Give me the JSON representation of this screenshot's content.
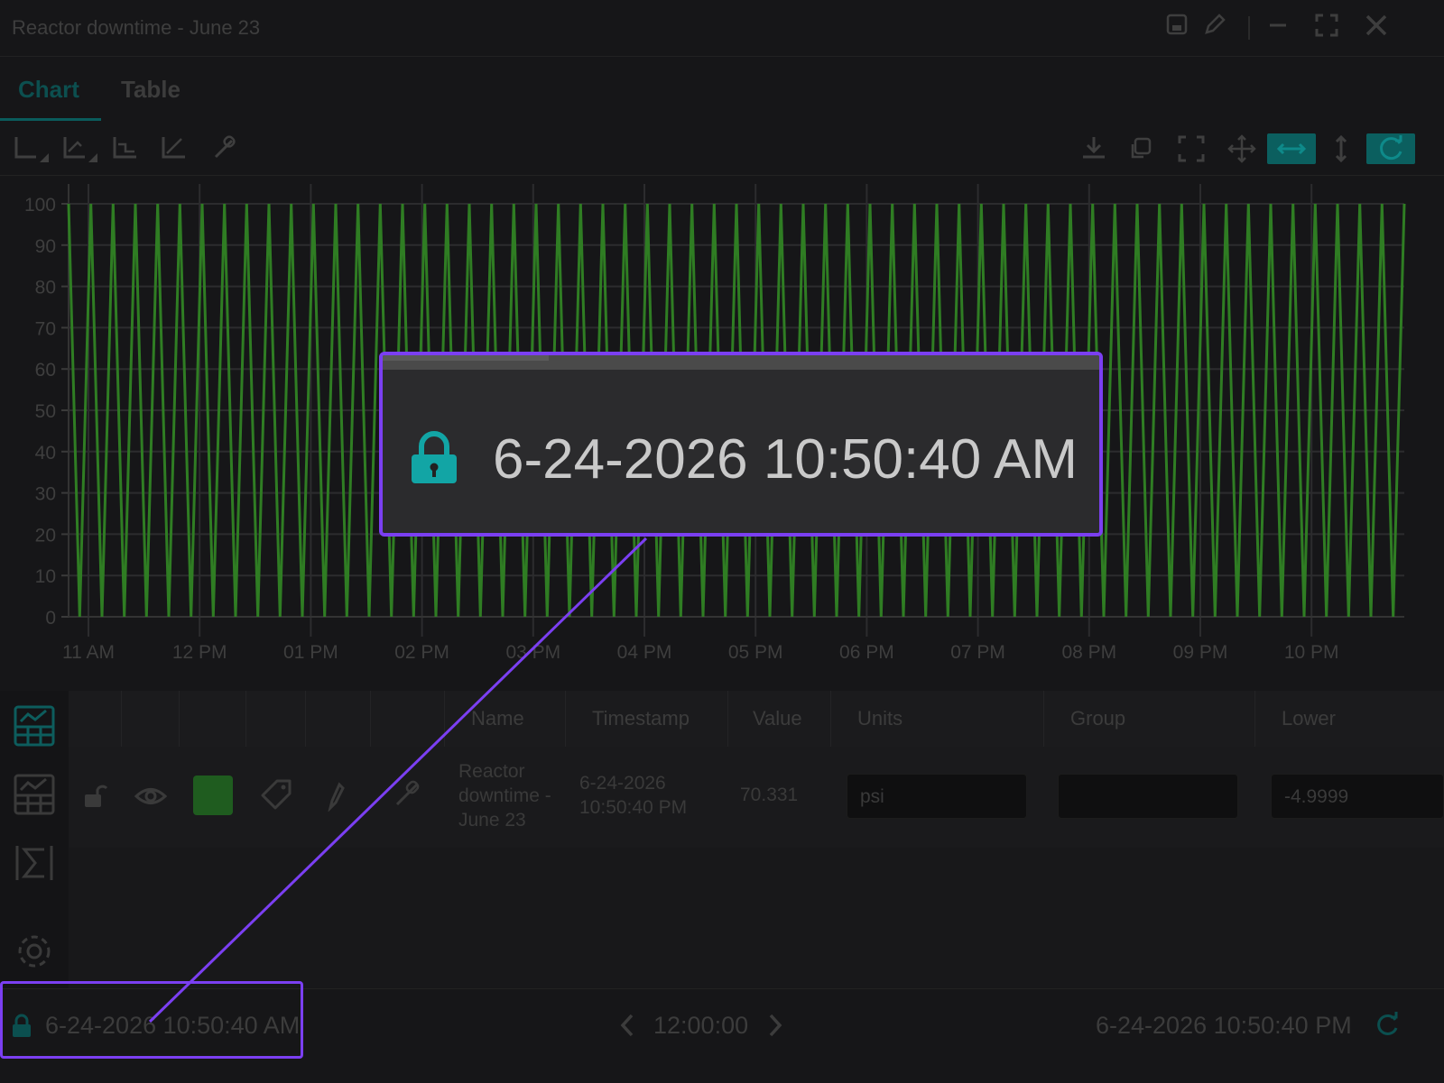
{
  "window": {
    "title": "Reactor downtime - June 23"
  },
  "titlebar_icons": [
    "save-icon",
    "pencil-icon",
    "minimize-icon",
    "maximize-icon",
    "close-icon"
  ],
  "tabs": [
    {
      "label": "Chart",
      "active": true
    },
    {
      "label": "Table",
      "active": false
    }
  ],
  "toolbar": {
    "left_tools": [
      "axis-icon",
      "axis-auto-icon",
      "axis-step-icon",
      "axis-trend-icon",
      "link-icon"
    ],
    "right_tools": [
      "download-icon",
      "copy-icon",
      "fullscreen-icon",
      "pan-icon",
      "horizontal-zoom-icon",
      "vertical-zoom-icon",
      "refresh-icon"
    ],
    "active_tools": [
      "horizontal-zoom-icon",
      "refresh-icon"
    ]
  },
  "chart_data": {
    "type": "line",
    "title": "",
    "xlabel": "",
    "ylabel": "",
    "ylim": [
      0,
      100
    ],
    "yticks": [
      0,
      10,
      20,
      30,
      40,
      50,
      60,
      70,
      80,
      90,
      100
    ],
    "xticks": [
      "11 AM",
      "12 PM",
      "01 PM",
      "02 PM",
      "03 PM",
      "04 PM",
      "05 PM",
      "06 PM",
      "07 PM",
      "08 PM",
      "09 PM",
      "10 PM"
    ],
    "grid": true,
    "series": [
      {
        "color": "#2f7d23",
        "pattern": "sawtooth oscillating between 0 and 100",
        "cycles": 60,
        "min": 0,
        "max": 100
      }
    ]
  },
  "sidebar_icons": [
    "chart-table-icon",
    "grid-icon",
    "sigma-icon",
    "settings-icon"
  ],
  "grid": {
    "columns": [
      "Name",
      "Timestamp",
      "Value",
      "Units",
      "Group",
      "Lower"
    ],
    "row": {
      "name": "Reactor downtime - June 23",
      "timestamp": "6-24-2026 10:50:40 PM",
      "value": "70.331",
      "units": "psi",
      "group": "",
      "lower": "-4.9999",
      "color": "#1f5c1f"
    },
    "row_icons": [
      "unlock-icon",
      "eye-icon",
      "color-swatch",
      "tag-icon",
      "pin-icon",
      "link-icon"
    ]
  },
  "statusbar": {
    "start": "6-24-2026 10:50:40 AM",
    "duration": "12:00:00",
    "end": "6-24-2026 10:50:40 PM"
  },
  "callout": {
    "text": "6-24-2026 10:50:40 AM",
    "icon": "lock-icon",
    "accent": "#7b3ff2"
  }
}
